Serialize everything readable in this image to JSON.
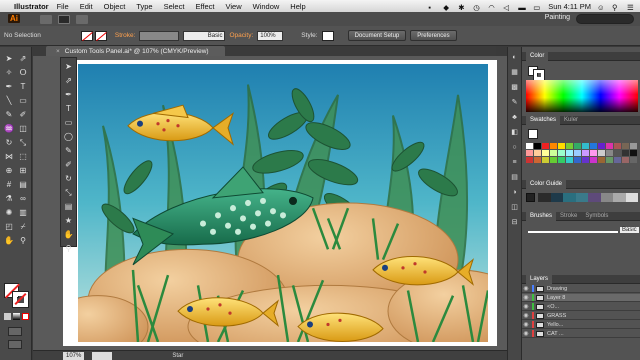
{
  "menubar": {
    "app_name": "Illustrator",
    "items": [
      "File",
      "Edit",
      "Object",
      "Type",
      "Select",
      "Effect",
      "View",
      "Window",
      "Help"
    ],
    "clock": "Sun 4:11 PM"
  },
  "appbar": {
    "logo": "Ai",
    "workspace": "Painting"
  },
  "controlbar": {
    "selection": "No Selection",
    "stroke_label": "Stroke:",
    "brush_value": "Basic",
    "opacity_label": "Opacity:",
    "opacity_value": "100%",
    "style_label": "Style:",
    "document_setup": "Document Setup",
    "preferences": "Preferences"
  },
  "document": {
    "tab_title": "Custom Tools Panel.ai* @ 107% (CMYK/Preview)"
  },
  "status": {
    "zoom": "107%",
    "tool": "Star"
  },
  "panels": {
    "color_title": "Color",
    "swatches_title": "Swatches",
    "kuler_title": "Kuler",
    "color_guide_title": "Color Guide",
    "brushes_title": "Brushes",
    "stroke_title": "Stroke",
    "symbols_title": "Symbols",
    "brush_basic": "Basic",
    "layers_title": "Layers",
    "layers": [
      {
        "name": "Drawing",
        "color": "#4a7fff"
      },
      {
        "name": "Layer 8",
        "color": "#3fbf3f"
      },
      {
        "name": "<O...",
        "color": "#3fbf3f"
      },
      {
        "name": "GRASS",
        "color": "#e04040"
      },
      {
        "name": "Yello...",
        "color": "#e04040"
      },
      {
        "name": "CAT ...",
        "color": "#e04040"
      }
    ]
  },
  "colors": {
    "accent_orange": "#ff7d00",
    "panel_bg": "#535353",
    "fish_yellow": "#f2c13a",
    "fish_green": "#2e8b57"
  }
}
